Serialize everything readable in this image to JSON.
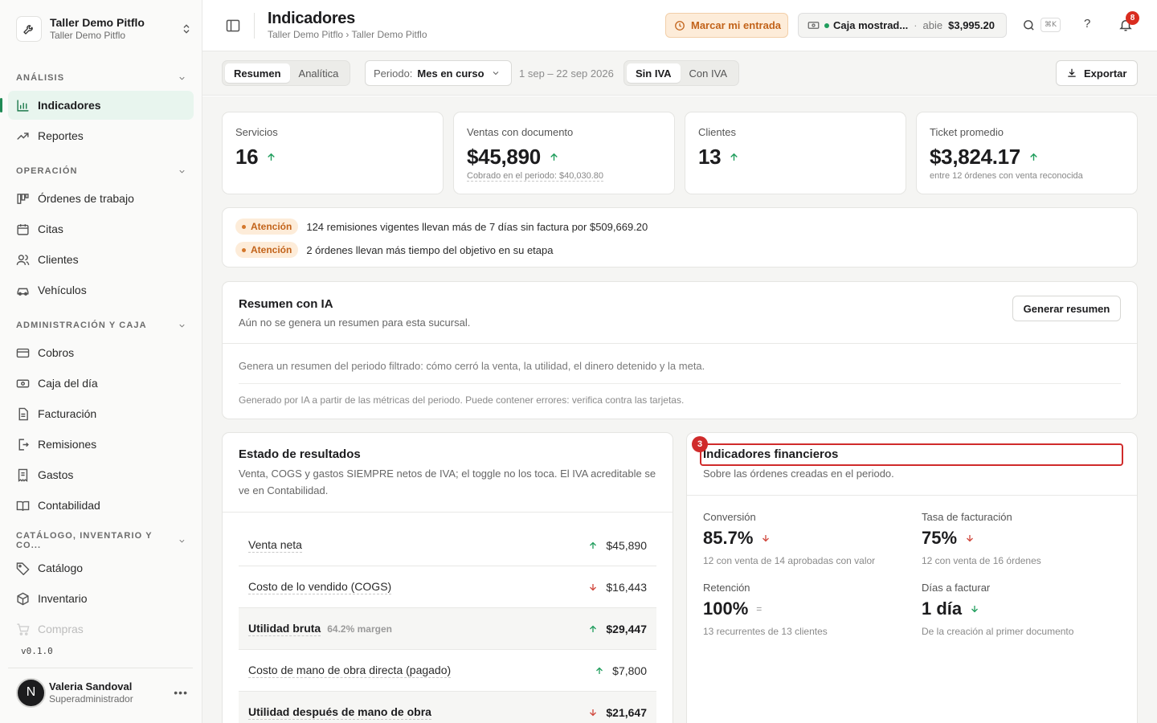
{
  "org": {
    "name": "Taller Demo Pitflo",
    "branch": "Taller Demo Pitflo"
  },
  "sidebar": {
    "sections": [
      {
        "label": "ANÁLISIS"
      },
      {
        "label": "OPERACIÓN"
      },
      {
        "label": "ADMINISTRACIÓN Y CAJA"
      },
      {
        "label": "CATÁLOGO, INVENTARIO Y CO..."
      }
    ],
    "items": [
      {
        "label": "Indicadores",
        "icon": "bar-chart-icon",
        "active": true
      },
      {
        "label": "Reportes",
        "icon": "trend-line-icon"
      },
      {
        "label": "Órdenes de trabajo",
        "icon": "kanban-icon"
      },
      {
        "label": "Citas",
        "icon": "calendar-icon"
      },
      {
        "label": "Clientes",
        "icon": "users-icon"
      },
      {
        "label": "Vehículos",
        "icon": "car-icon"
      },
      {
        "label": "Cobros",
        "icon": "credit-card-icon"
      },
      {
        "label": "Caja del día",
        "icon": "cash-register-icon"
      },
      {
        "label": "Facturación",
        "icon": "document-icon"
      },
      {
        "label": "Remisiones",
        "icon": "file-export-icon"
      },
      {
        "label": "Gastos",
        "icon": "receipt-icon"
      },
      {
        "label": "Contabilidad",
        "icon": "book-icon"
      },
      {
        "label": "Catálogo",
        "icon": "tag-icon"
      },
      {
        "label": "Inventario",
        "icon": "box-icon"
      },
      {
        "label": "Compras",
        "icon": "cart-icon"
      }
    ],
    "version": "v0.1.0",
    "user": {
      "initial": "N",
      "name": "Valeria Sandoval",
      "role": "Superadministrador"
    }
  },
  "header": {
    "title": "Indicadores",
    "breadcrumb": "Taller Demo Pitflo › Taller Demo Pitflo",
    "clock_in_label": "Marcar mi entrada",
    "cash": {
      "name": "Caja mostrad...",
      "status": "abie",
      "amount": "$3,995.20"
    },
    "shortcut": "⌘K",
    "help": "?",
    "notifications": "8"
  },
  "filters": {
    "tabs": [
      "Resumen",
      "Analítica"
    ],
    "period_label": "Periodo:",
    "period_value": "Mes en curso",
    "range": "1 sep – 22 sep 2026",
    "tax_tabs": [
      "Sin IVA",
      "Con IVA"
    ],
    "export_label": "Exportar"
  },
  "kpis": [
    {
      "label": "Servicios",
      "value": "16",
      "trend": "up"
    },
    {
      "label": "Ventas con documento",
      "value": "$45,890",
      "trend": "up",
      "sub": "Cobrado en el periodo: $40,030.80"
    },
    {
      "label": "Clientes",
      "value": "13",
      "trend": "up"
    },
    {
      "label": "Ticket promedio",
      "value": "$3,824.17",
      "trend": "up",
      "sub": "entre 12 órdenes con venta reconocida"
    }
  ],
  "alerts": [
    {
      "tag": "Atención",
      "text": "124 remisiones vigentes llevan más de 7 días sin factura por $509,669.20"
    },
    {
      "tag": "Atención",
      "text": "2 órdenes llevan más tiempo del objetivo en su etapa"
    }
  ],
  "ai_summary": {
    "title": "Resumen con IA",
    "subtitle": "Aún no se genera un resumen para esta sucursal.",
    "button": "Generar resumen",
    "description": "Genera un resumen del periodo filtrado: cómo cerró la venta, la utilidad, el dinero detenido y la meta.",
    "note": "Generado por IA a partir de las métricas del periodo. Puede contener errores: verifica contra las tarjetas."
  },
  "income_statement": {
    "title": "Estado de resultados",
    "subtitle": "Venta, COGS y gastos SIEMPRE netos de IVA; el toggle no los toca. El IVA acreditable se ve en Contabilidad.",
    "rows": [
      {
        "label": "Venta neta",
        "value": "$45,890",
        "trend": "up"
      },
      {
        "label": "Costo de lo vendido (COGS)",
        "value": "$16,443",
        "trend": "down"
      },
      {
        "label": "Utilidad bruta",
        "margin": "64.2% margen",
        "value": "$29,447",
        "trend": "up",
        "highlight": true
      },
      {
        "label": "Costo de mano de obra directa (pagado)",
        "value": "$7,800",
        "trend": "up"
      },
      {
        "label": "Utilidad después de mano de obra",
        "value": "$21,647",
        "trend": "down",
        "highlight": true
      }
    ]
  },
  "financial_indicators": {
    "title": "Indicadores financieros",
    "subtitle": "Sobre las órdenes creadas en el periodo.",
    "marker": "3",
    "metrics": [
      {
        "label": "Conversión",
        "value": "85.7%",
        "trend": "down",
        "sub": "12 con venta de 14 aprobadas con valor"
      },
      {
        "label": "Tasa de facturación",
        "value": "75%",
        "trend": "down",
        "sub": "12 con venta de 16 órdenes"
      },
      {
        "label": "Retención",
        "value": "100%",
        "trend": "flat",
        "trend_symbol": "=",
        "sub": "13 recurrentes de 13 clientes"
      },
      {
        "label": "Días a facturar",
        "value": "1 día",
        "trend": "down",
        "sub": "De la creación al primer documento"
      }
    ]
  },
  "colors": {
    "accent": "#1f8a55",
    "warning_bg": "#fdecd9",
    "warning_text": "#c2631a",
    "up": "#1f9d5c",
    "down": "#d0453a",
    "highlight": "#d02b2b"
  }
}
